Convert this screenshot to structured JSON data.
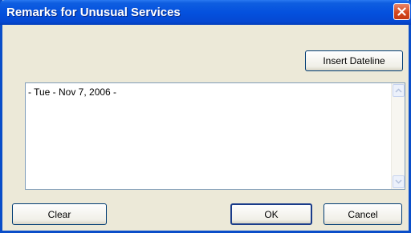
{
  "window": {
    "title": "Remarks for Unusual Services"
  },
  "buttons": {
    "insert_dateline": "Insert Dateline",
    "clear": "Clear",
    "ok": "OK",
    "cancel": "Cancel"
  },
  "remarks": {
    "value": "- Tue - Nov 7, 2006 -"
  },
  "icons": {
    "close": "close-icon",
    "scroll_up": "arrow-up-icon",
    "scroll_down": "arrow-down-icon"
  },
  "colors": {
    "titlebar": "#0451de",
    "dialog_bg": "#ece9d8",
    "close_button": "#d5481e"
  }
}
